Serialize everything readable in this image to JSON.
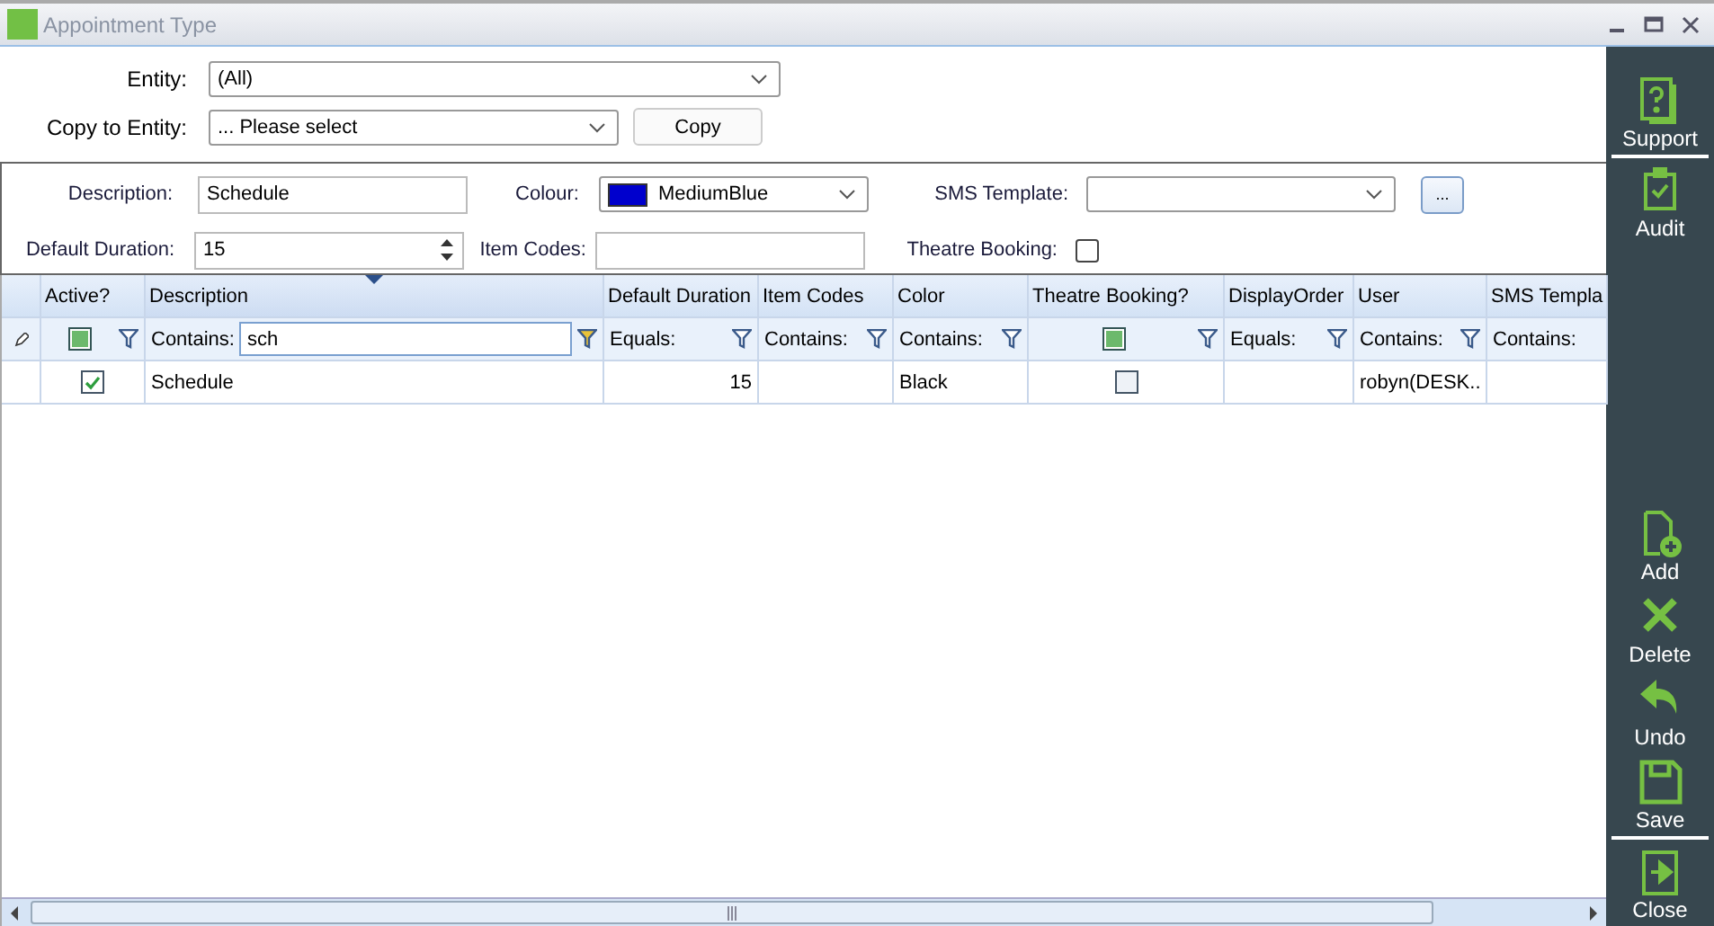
{
  "window": {
    "title": "Appointment Type"
  },
  "entity": {
    "label": "Entity:",
    "value": "(All)"
  },
  "copy_to_entity": {
    "label": "Copy to Entity:",
    "value": "... Please select",
    "button": "Copy"
  },
  "form": {
    "description_label": "Description:",
    "description": "Schedule",
    "colour_label": "Colour:",
    "colour": "MediumBlue",
    "sms_label": "SMS Template:",
    "sms_button": "...",
    "duration_label": "Default Duration:",
    "duration": "15",
    "item_codes_label": "Item Codes:",
    "theatre_label": "Theatre Booking:",
    "theatre_checked": false
  },
  "grid": {
    "columns": [
      {
        "header": "Active?",
        "kind": "check",
        "filter_indeterminate": true
      },
      {
        "header": "Description",
        "kind": "text",
        "filter_op": "Contains:",
        "filter_value": "sch",
        "filter_active": true,
        "sorted": true
      },
      {
        "header": "Default Duration",
        "kind": "num",
        "filter_op": "Equals:",
        "filter_active": false,
        "sorted": false
      },
      {
        "header": "Item Codes",
        "kind": "text",
        "filter_op": "Contains:",
        "filter_active": false,
        "sorted": false
      },
      {
        "header": "Color",
        "kind": "text",
        "filter_op": "Contains:",
        "filter_active": false,
        "sorted": false
      },
      {
        "header": "Theatre Booking?",
        "kind": "check",
        "filter_indeterminate": true
      },
      {
        "header": "DisplayOrder",
        "kind": "num",
        "filter_op": "Equals:",
        "filter_active": false,
        "sorted": false
      },
      {
        "header": "User",
        "kind": "text",
        "filter_op": "Contains:",
        "filter_active": false,
        "sorted": false
      },
      {
        "header": "SMS Templa",
        "kind": "text",
        "filter_op": "Contains:"
      }
    ],
    "rows": [
      {
        "cells": [
          {
            "checked": true
          },
          {
            "text": "Schedule"
          },
          {
            "text": "15"
          },
          {},
          {
            "text": "Black"
          },
          {
            "checked": false
          },
          {},
          {
            "text": "robyn(DESK.."
          },
          {}
        ]
      }
    ]
  },
  "sidebar": [
    {
      "kind": "support",
      "label": "Support"
    },
    {
      "kind": "audit",
      "label": "Audit"
    },
    {
      "kind": "gap"
    },
    {
      "kind": "add",
      "label": "Add"
    },
    {
      "kind": "delete",
      "label": "Delete"
    },
    {
      "kind": "undo",
      "label": "Undo"
    },
    {
      "kind": "save",
      "label": "Save"
    },
    {
      "kind": "close",
      "label": "Close"
    }
  ]
}
